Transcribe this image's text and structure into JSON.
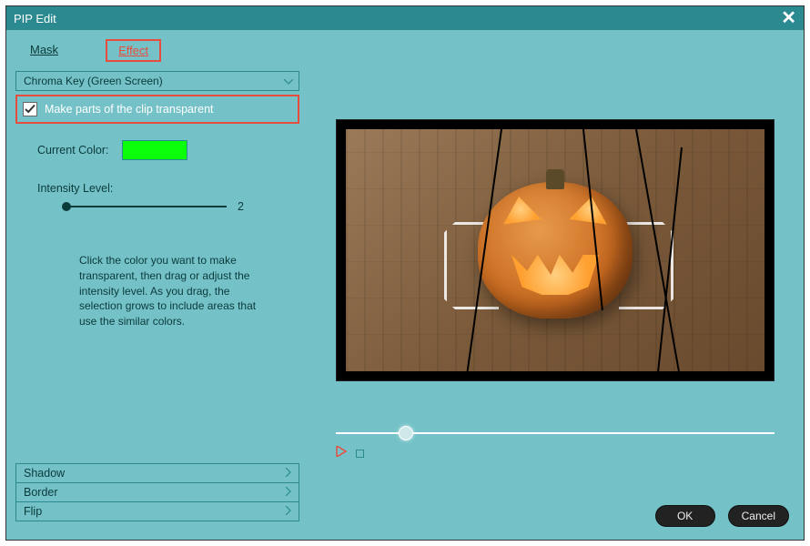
{
  "titlebar": {
    "title": "PIP Edit"
  },
  "tabs": {
    "mask": "Mask",
    "effect": "Effect"
  },
  "dropdown": {
    "selected": "Chroma Key (Green Screen)"
  },
  "transparency": {
    "checkbox_label": "Make parts of the clip transparent"
  },
  "color_row": {
    "label": "Current Color:",
    "value": "#0bff0b"
  },
  "intensity": {
    "label": "Intensity Level:",
    "value": "2"
  },
  "help_text": "Click the color you want to make transparent, then drag or adjust the intensity level. As you drag, the selection grows to include areas that use the similar colors.",
  "accordions": {
    "shadow": "Shadow",
    "border": "Border",
    "flip": "Flip"
  },
  "footer": {
    "ok": "OK",
    "cancel": "Cancel"
  }
}
